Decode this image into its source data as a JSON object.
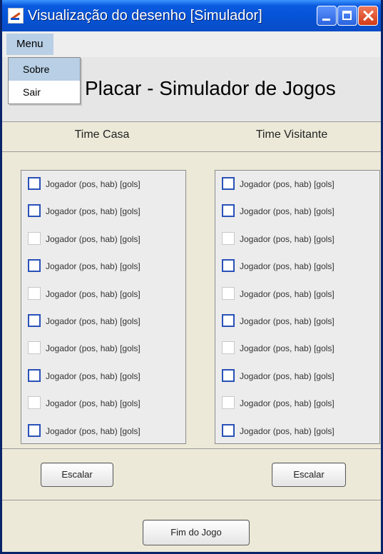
{
  "window": {
    "title": "Visualização do desenho [Simulador]"
  },
  "menubar": {
    "menu_label": "Menu",
    "popup_items": [
      "Sobre",
      "Sair"
    ]
  },
  "header": {
    "title": "Placar - Simulador de Jogos"
  },
  "teams": {
    "home_label": "Time Casa",
    "away_label": "Time Visitante"
  },
  "home_players": [
    "Jogador (pos, hab) [gols]",
    "Jogador (pos, hab) [gols]",
    "Jogador (pos, hab) [gols]",
    "Jogador (pos, hab) [gols]",
    "Jogador (pos, hab) [gols]",
    "Jogador (pos, hab) [gols]",
    "Jogador (pos, hab) [gols]",
    "Jogador (pos, hab) [gols]",
    "Jogador (pos, hab) [gols]",
    "Jogador (pos, hab) [gols]"
  ],
  "away_players": [
    "Jogador (pos, hab) [gols]",
    "Jogador (pos, hab) [gols]",
    "Jogador (pos, hab) [gols]",
    "Jogador (pos, hab) [gols]",
    "Jogador (pos, hab) [gols]",
    "Jogador (pos, hab) [gols]",
    "Jogador (pos, hab) [gols]",
    "Jogador (pos, hab) [gols]",
    "Jogador (pos, hab) [gols]",
    "Jogador (pos, hab) [gols]"
  ],
  "buttons": {
    "escalar_home": "Escalar",
    "escalar_away": "Escalar",
    "finish": "Fim do Jogo"
  },
  "colors": {
    "title_bar": "#0553d6",
    "close_button": "#d23a14",
    "menu_highlight": "#b8cfe5",
    "checkbox_border": "#2a51b8"
  }
}
